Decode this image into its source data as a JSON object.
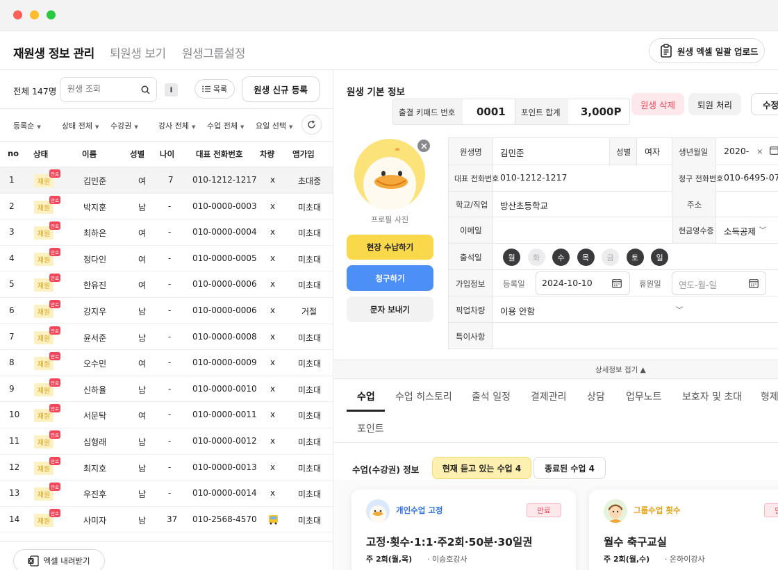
{
  "header": {
    "title": "재원생 정보 관리",
    "tab2": "퇴원생 보기",
    "tab3": "원생그룹설정",
    "upload": "원생 엑셀 일괄 업로드"
  },
  "left": {
    "total": "전체 147명",
    "search_placeholder": "원생 조회",
    "info": "i",
    "list_btn": "목록",
    "new_btn": "원생 신규 등록",
    "filters": [
      "등록순",
      "상태 전체",
      "수강권",
      "강사 전체",
      "수업 전체",
      "요일 선택"
    ],
    "columns": [
      "no",
      "상태",
      "이름",
      "성별",
      "나이",
      "대표 전화번호",
      "차량",
      "앱가입"
    ],
    "status_label": "재원",
    "status_badge": "만료",
    "rows": [
      {
        "no": "1",
        "name": "김민준",
        "gender": "여",
        "age": "7",
        "phone": "010-1212-1217",
        "car": "x",
        "app": "초대중"
      },
      {
        "no": "2",
        "name": "박지훈",
        "gender": "남",
        "age": "-",
        "phone": "010-0000-0003",
        "car": "x",
        "app": "미초대"
      },
      {
        "no": "3",
        "name": "최하은",
        "gender": "여",
        "age": "-",
        "phone": "010-0000-0004",
        "car": "x",
        "app": "미초대"
      },
      {
        "no": "4",
        "name": "정다인",
        "gender": "여",
        "age": "-",
        "phone": "010-0000-0005",
        "car": "x",
        "app": "미초대"
      },
      {
        "no": "5",
        "name": "한유진",
        "gender": "여",
        "age": "-",
        "phone": "010-0000-0006",
        "car": "x",
        "app": "미초대"
      },
      {
        "no": "6",
        "name": "강지우",
        "gender": "남",
        "age": "-",
        "phone": "010-0000-0006",
        "car": "x",
        "app": "거절"
      },
      {
        "no": "7",
        "name": "윤서준",
        "gender": "남",
        "age": "-",
        "phone": "010-0000-0008",
        "car": "x",
        "app": "미초대"
      },
      {
        "no": "8",
        "name": "오수민",
        "gender": "여",
        "age": "-",
        "phone": "010-0000-0009",
        "car": "x",
        "app": "미초대"
      },
      {
        "no": "9",
        "name": "신하율",
        "gender": "남",
        "age": "-",
        "phone": "010-0000-0010",
        "car": "x",
        "app": "미초대"
      },
      {
        "no": "10",
        "name": "서문탁",
        "gender": "여",
        "age": "-",
        "phone": "010-0000-0011",
        "car": "x",
        "app": "미초대"
      },
      {
        "no": "11",
        "name": "심형래",
        "gender": "남",
        "age": "-",
        "phone": "010-0000-0012",
        "car": "x",
        "app": "미초대"
      },
      {
        "no": "12",
        "name": "최지호",
        "gender": "남",
        "age": "-",
        "phone": "010-0000-0013",
        "car": "x",
        "app": "미초대"
      },
      {
        "no": "13",
        "name": "우진후",
        "gender": "남",
        "age": "-",
        "phone": "010-0000-0014",
        "car": "x",
        "app": "미초대"
      },
      {
        "no": "14",
        "name": "사미자",
        "gender": "남",
        "age": "37",
        "phone": "010-2568-4570",
        "car": "",
        "app": "미초대"
      }
    ],
    "excel_btn": "엑셀 내려받기"
  },
  "detail": {
    "section_title": "원생 기본 정보",
    "keypad_label": "출결 키패드 번호",
    "keypad_value": "0001",
    "points_label": "포인트 합계",
    "points_value": "3,000P",
    "delete_btn": "원생 삭제",
    "withdraw_btn": "퇴원 처리",
    "edit_btn": "수정",
    "profile_caption": "프로필 사진",
    "pay_btn": "현장 수납하기",
    "bill_btn": "청구하기",
    "sms_btn": "문자 보내기",
    "name_label": "원생명",
    "name_value": "김민준",
    "gender_label": "성별",
    "gender_value": "여자",
    "birth_label": "생년월일",
    "birth_value": "2020-",
    "phone_label": "대표 전화번호",
    "phone_value": "010-1212-1217",
    "bill_phone_label": "청구 전화번호",
    "bill_phone_value": "010-6495-07",
    "school_label": "학교/직업",
    "school_value": "방산초등학교",
    "address_label": "주소",
    "email_label": "이메일",
    "receipt_label": "현금영수증",
    "receipt_value": "소득공제",
    "attend_label": "출석일",
    "days": [
      "월",
      "화",
      "수",
      "목",
      "금",
      "토",
      "일"
    ],
    "join_label": "가입정보",
    "reg_label": "등록일",
    "reg_value": "2024-10-10",
    "leave_label": "휴원일",
    "leave_placeholder": "연도-월-일",
    "pickup_label": "픽업차량",
    "pickup_value": "이용 안함",
    "note_label": "특이사항",
    "collapse": "상세정보 접기 ▲"
  },
  "tabs": [
    "수업",
    "수업 히스토리",
    "출석 일정",
    "결제관리",
    "상담",
    "업무노트",
    "보호자 및 초대",
    "형제",
    "포인트"
  ],
  "lesson": {
    "title": "수업(수강권) 정보",
    "current_btn": "현재 듣고 있는 수업 4",
    "ended_btn": "종료된 수업 4"
  },
  "cards": [
    {
      "type": "개인수업 고정",
      "badge": "만료",
      "title": "고정·횟수·1:1·주2회·50분·30일권",
      "sub_days": "주 2회(월,목)",
      "sub_teacher": "· 이승호강사"
    },
    {
      "type": "그룹수업 횟수",
      "badge": "만료",
      "title": "월수 축구교실",
      "sub_days": "주 2회(월,수)",
      "sub_teacher": "· 온하이강사"
    }
  ],
  "colors": {
    "accent": "#f9d84a",
    "blue": "#4b8ff7",
    "danger": "#f2475b",
    "muted": "#f2f2f3"
  }
}
